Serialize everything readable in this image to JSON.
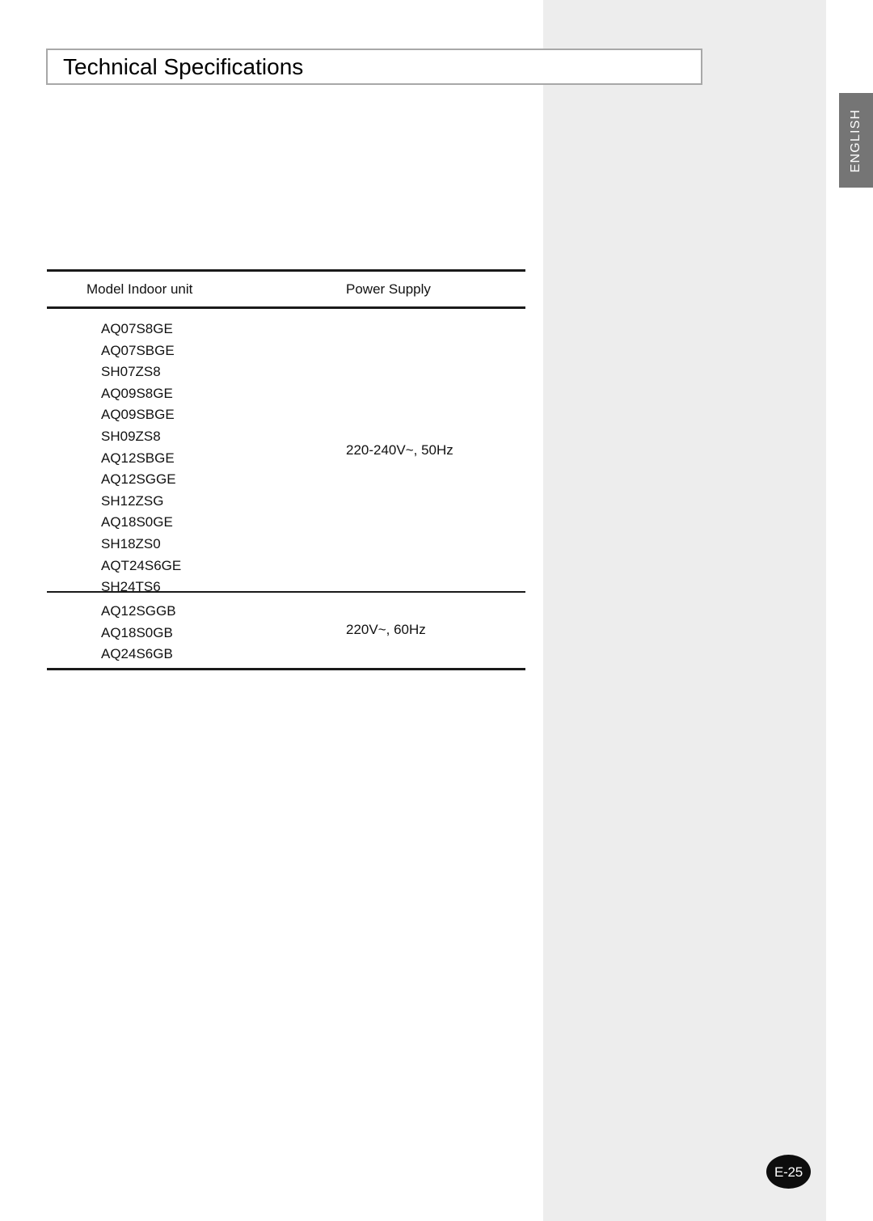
{
  "page": {
    "title": "Technical Specifications",
    "language_tab": "ENGLISH",
    "page_number": "E-25"
  },
  "table": {
    "headers": {
      "model": "Model Indoor unit",
      "power": "Power Supply"
    },
    "groups": [
      {
        "power_supply": "220-240V~, 50Hz",
        "models": [
          "AQ07S8GE",
          "AQ07SBGE",
          "SH07ZS8",
          "AQ09S8GE",
          "AQ09SBGE",
          "SH09ZS8",
          "AQ12SBGE",
          "AQ12SGGE",
          "SH12ZSG",
          "AQ18S0GE",
          "SH18ZS0",
          "AQT24S6GE",
          "SH24TS6"
        ]
      },
      {
        "power_supply": "220V~, 60Hz",
        "models": [
          "AQ12SGGB",
          "AQ18S0GB",
          "AQ24S6GB"
        ]
      }
    ]
  },
  "colors": {
    "panel_gray": "#ededed",
    "tab_gray": "#757575",
    "rule_black": "#1a1a1a",
    "badge_black": "#0d0d0d",
    "title_border": "#a8a8a8"
  }
}
